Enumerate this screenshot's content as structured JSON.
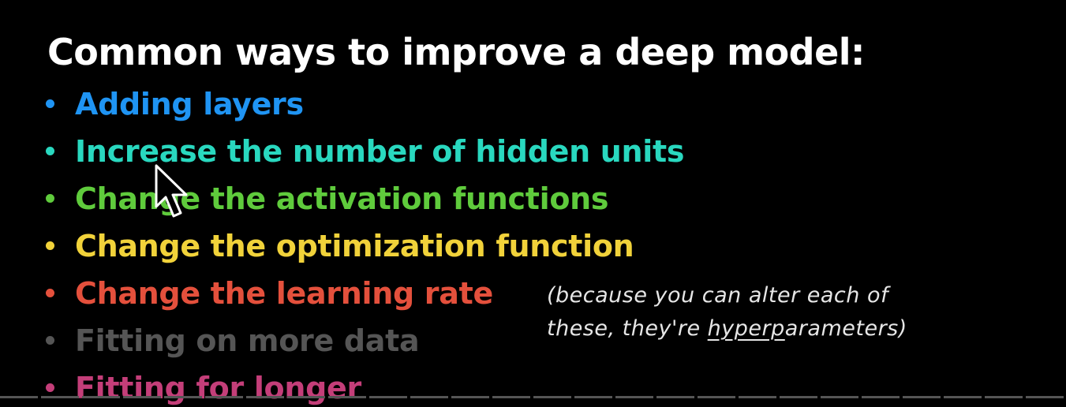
{
  "slide": {
    "title": "Common ways to improve a deep model:",
    "bullets": [
      {
        "label": "Adding layers",
        "color": "#1f94f3"
      },
      {
        "label": "Increase the number of hidden units",
        "color": "#29d8bf"
      },
      {
        "label": "Change the activation functions",
        "color": "#5fcb3c"
      },
      {
        "label": "Change the optimization function",
        "color": "#f1d23a"
      },
      {
        "label": "Change the learning rate",
        "color": "#e4503c"
      },
      {
        "label": "Fitting on more data",
        "color": "#555555"
      },
      {
        "label": "Fitting for longer",
        "color": "#c43e79"
      }
    ],
    "note": {
      "line1": "(because you can alter each of",
      "line2_pre": "these, they're ",
      "line2_highlight": "hyperp",
      "line2_post": "arameters)"
    }
  },
  "cursor": {
    "icon": "mouse-pointer-icon"
  },
  "video": {
    "progress_icon": "progress-bar"
  }
}
